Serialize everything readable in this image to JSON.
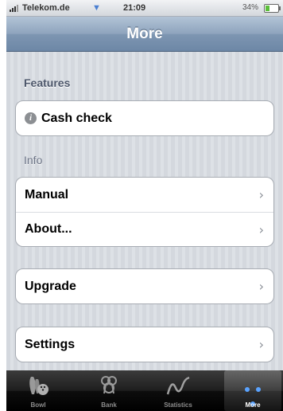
{
  "status_bar": {
    "carrier": "Telekom.de",
    "time": "21:09",
    "battery_percent_text": "34%",
    "battery_level": 0.34
  },
  "nav_bar": {
    "title": "More"
  },
  "sections": {
    "features": {
      "header": "Features",
      "items": [
        {
          "label": "Cash check",
          "icon": "info-icon"
        }
      ]
    },
    "info": {
      "header": "Info",
      "items": [
        {
          "label": "Manual"
        },
        {
          "label": "About..."
        }
      ]
    },
    "upgrade": {
      "items": [
        {
          "label": "Upgrade"
        }
      ]
    },
    "settings": {
      "items": [
        {
          "label": "Settings"
        }
      ]
    }
  },
  "tab_bar": {
    "tabs": [
      {
        "label": "Bowl",
        "icon": "bowling-icon"
      },
      {
        "label": "Bank",
        "icon": "bank-icon"
      },
      {
        "label": "Statistics",
        "icon": "statistics-icon"
      },
      {
        "label": "More",
        "icon": "more-icon",
        "selected": true
      }
    ]
  },
  "colors": {
    "nav_bar": "#7e96b2",
    "selected_tab_dots": "#5aa3ff"
  }
}
